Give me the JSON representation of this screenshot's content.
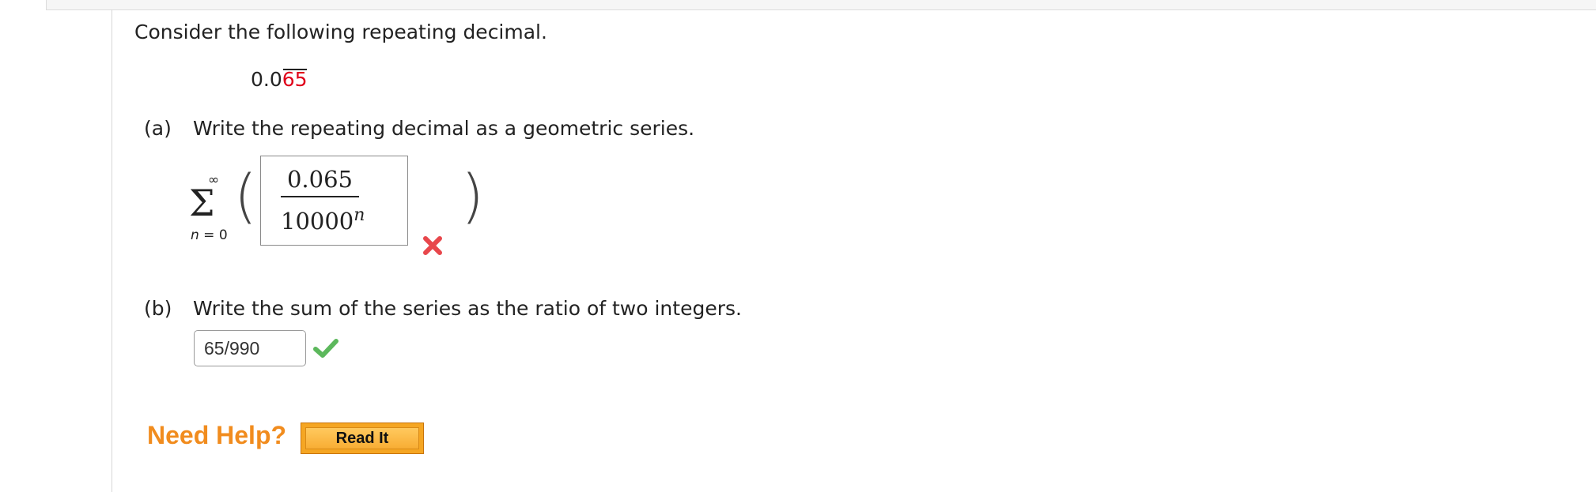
{
  "prompt": "Consider the following repeating decimal.",
  "decimal": {
    "prefix": "0.0",
    "repeating": "65"
  },
  "part_a": {
    "label": "(a)",
    "question": "Write the repeating decimal as a geometric series.",
    "sum_upper": "∞",
    "sum_var": "n",
    "sum_eq": " = 0",
    "numerator": "0.065",
    "denominator_base": "10000",
    "denominator_exp": "n",
    "status": "incorrect"
  },
  "part_b": {
    "label": "(b)",
    "question": "Write the sum of the series as the ratio of two integers.",
    "answer": "65/990",
    "status": "correct"
  },
  "help": {
    "label": "Need Help?",
    "read_it_label": "Read It"
  },
  "colors": {
    "repeat_digits": "#e0001a",
    "help_orange": "#f18c1e",
    "incorrect": "#e8474c",
    "correct": "#5cb85c"
  }
}
